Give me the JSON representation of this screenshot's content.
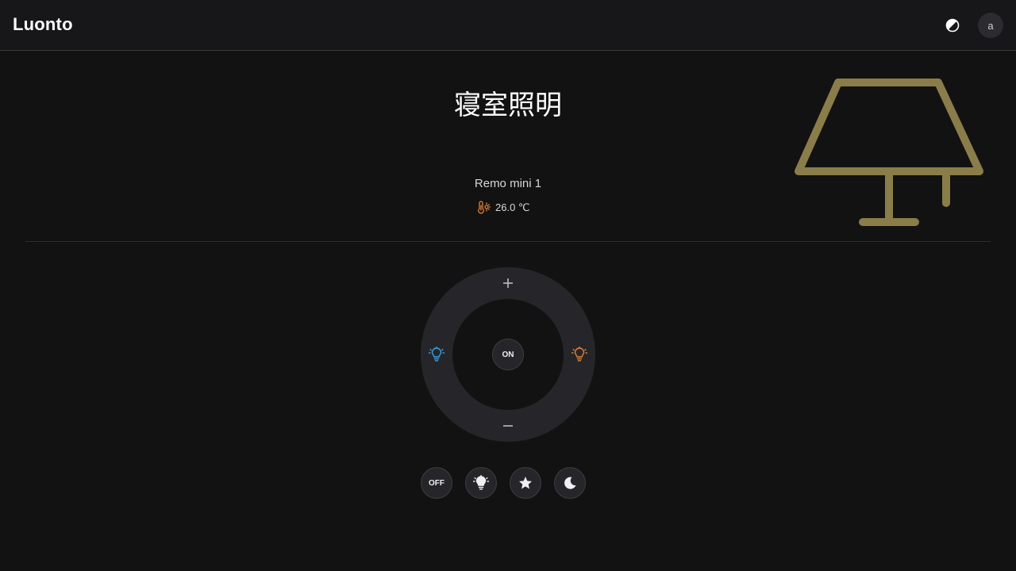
{
  "app": {
    "brand": "Luonto"
  },
  "header": {
    "theme_icon": "contrast-icon",
    "avatar_letter": "a"
  },
  "appliance": {
    "title": "寝室照明",
    "icon": "lamp-icon",
    "icon_color": "#8a7d4a",
    "device_name": "Remo mini 1",
    "temperature": "26.0 ℃",
    "temperature_icon": "thermometer-sun-icon",
    "temperature_icon_color": "#e0823a"
  },
  "controls": {
    "dial": {
      "up_icon": "plus-icon",
      "down_icon": "minus-icon",
      "cool_icon": "bulb-cool-icon",
      "cool_color": "#3aa0e6",
      "warm_icon": "bulb-warm-icon",
      "warm_color": "#e0823a",
      "center_label": "ON"
    },
    "buttons": [
      {
        "label": "OFF",
        "icon": null
      },
      {
        "label": "",
        "icon": "bulb-full-icon"
      },
      {
        "label": "",
        "icon": "star-icon"
      },
      {
        "label": "",
        "icon": "moon-icon"
      }
    ]
  }
}
